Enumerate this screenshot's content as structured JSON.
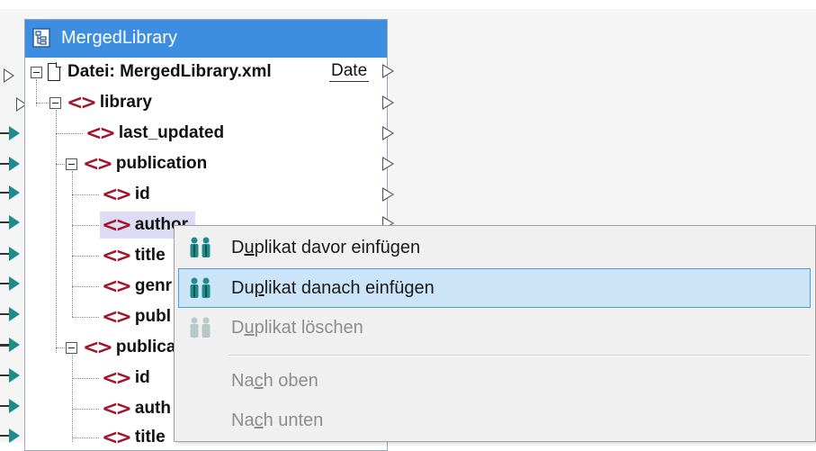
{
  "component": {
    "title": "MergedLibrary",
    "file_label": "Datei: MergedLibrary.xml",
    "file_button": "Date",
    "nodes": {
      "library": "library",
      "last_updated": "last_updated",
      "publication1": "publication",
      "id1": "id",
      "author1": "author",
      "title1": "title",
      "genre1": "genr",
      "publisher1": "publ",
      "publication2": "publica",
      "id2": "id",
      "author2": "auth",
      "title2": "title"
    }
  },
  "context_menu": {
    "items": [
      {
        "pre": "D",
        "ul": "u",
        "post": "plikat davor einfügen",
        "state": "enabled"
      },
      {
        "pre": "Du",
        "ul": "p",
        "post": "likat danach einfügen",
        "state": "selected"
      },
      {
        "pre": "D",
        "ul": "u",
        "post": "plikat löschen",
        "state": "disabled"
      },
      {
        "pre": "Na",
        "ul": "c",
        "post": "h oben",
        "state": "disabled"
      },
      {
        "pre": "Na",
        "ul": "c",
        "post": "h unten",
        "state": "disabled"
      }
    ]
  },
  "colors": {
    "title_bar": "#3d8ee0",
    "tag": "#a3152b",
    "connector": "#1f8c8c",
    "menu_selected": "#cce4f7"
  },
  "icons": [
    "component-icon",
    "document-icon",
    "element-tag-icon",
    "duplicate-icon"
  ]
}
